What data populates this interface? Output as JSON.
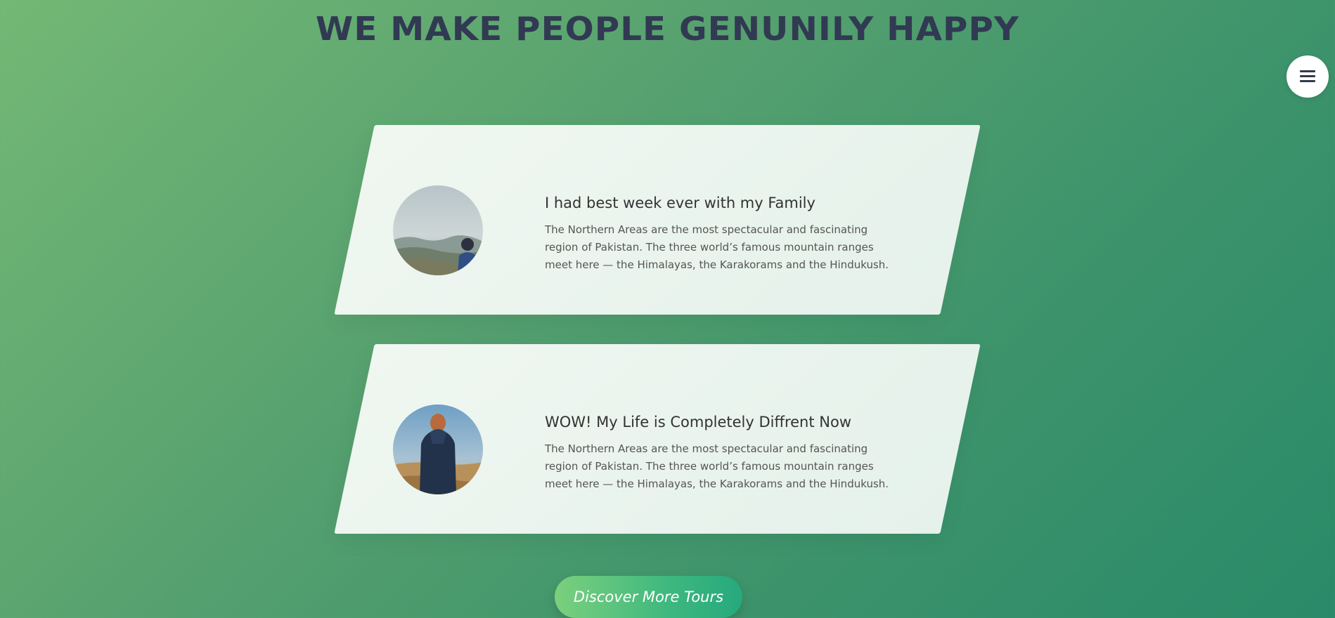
{
  "heading": "WE MAKE PEOPLE GENUNILY HAPPY",
  "menu_icon": "hamburger-icon",
  "stories": [
    {
      "title": "I had best week ever with my Family",
      "text": "The Northern Areas are the most spectacular and fascinating region of Pakistan. The three world’s famous mountain ranges meet here — the Himalayas, the Karakorams and the Hindukush.",
      "avatar_icon": "user-photo-1"
    },
    {
      "title": "WOW! My Life is Completely Diffrent Now",
      "text": "The Northern Areas are the most spectacular and fascinating region of Pakistan. The three world’s famous mountain ranges meet here — the Himalayas, the Karakorams and the Hindukush.",
      "avatar_icon": "user-photo-2"
    }
  ],
  "cta_label": "Discover More Tours",
  "colors": {
    "heading": "#313a52",
    "bg_start": "#74b875",
    "bg_end": "#2a8a69",
    "card": "#f2f8f4",
    "cta_start": "#7bd07d",
    "cta_end": "#26a97e"
  }
}
